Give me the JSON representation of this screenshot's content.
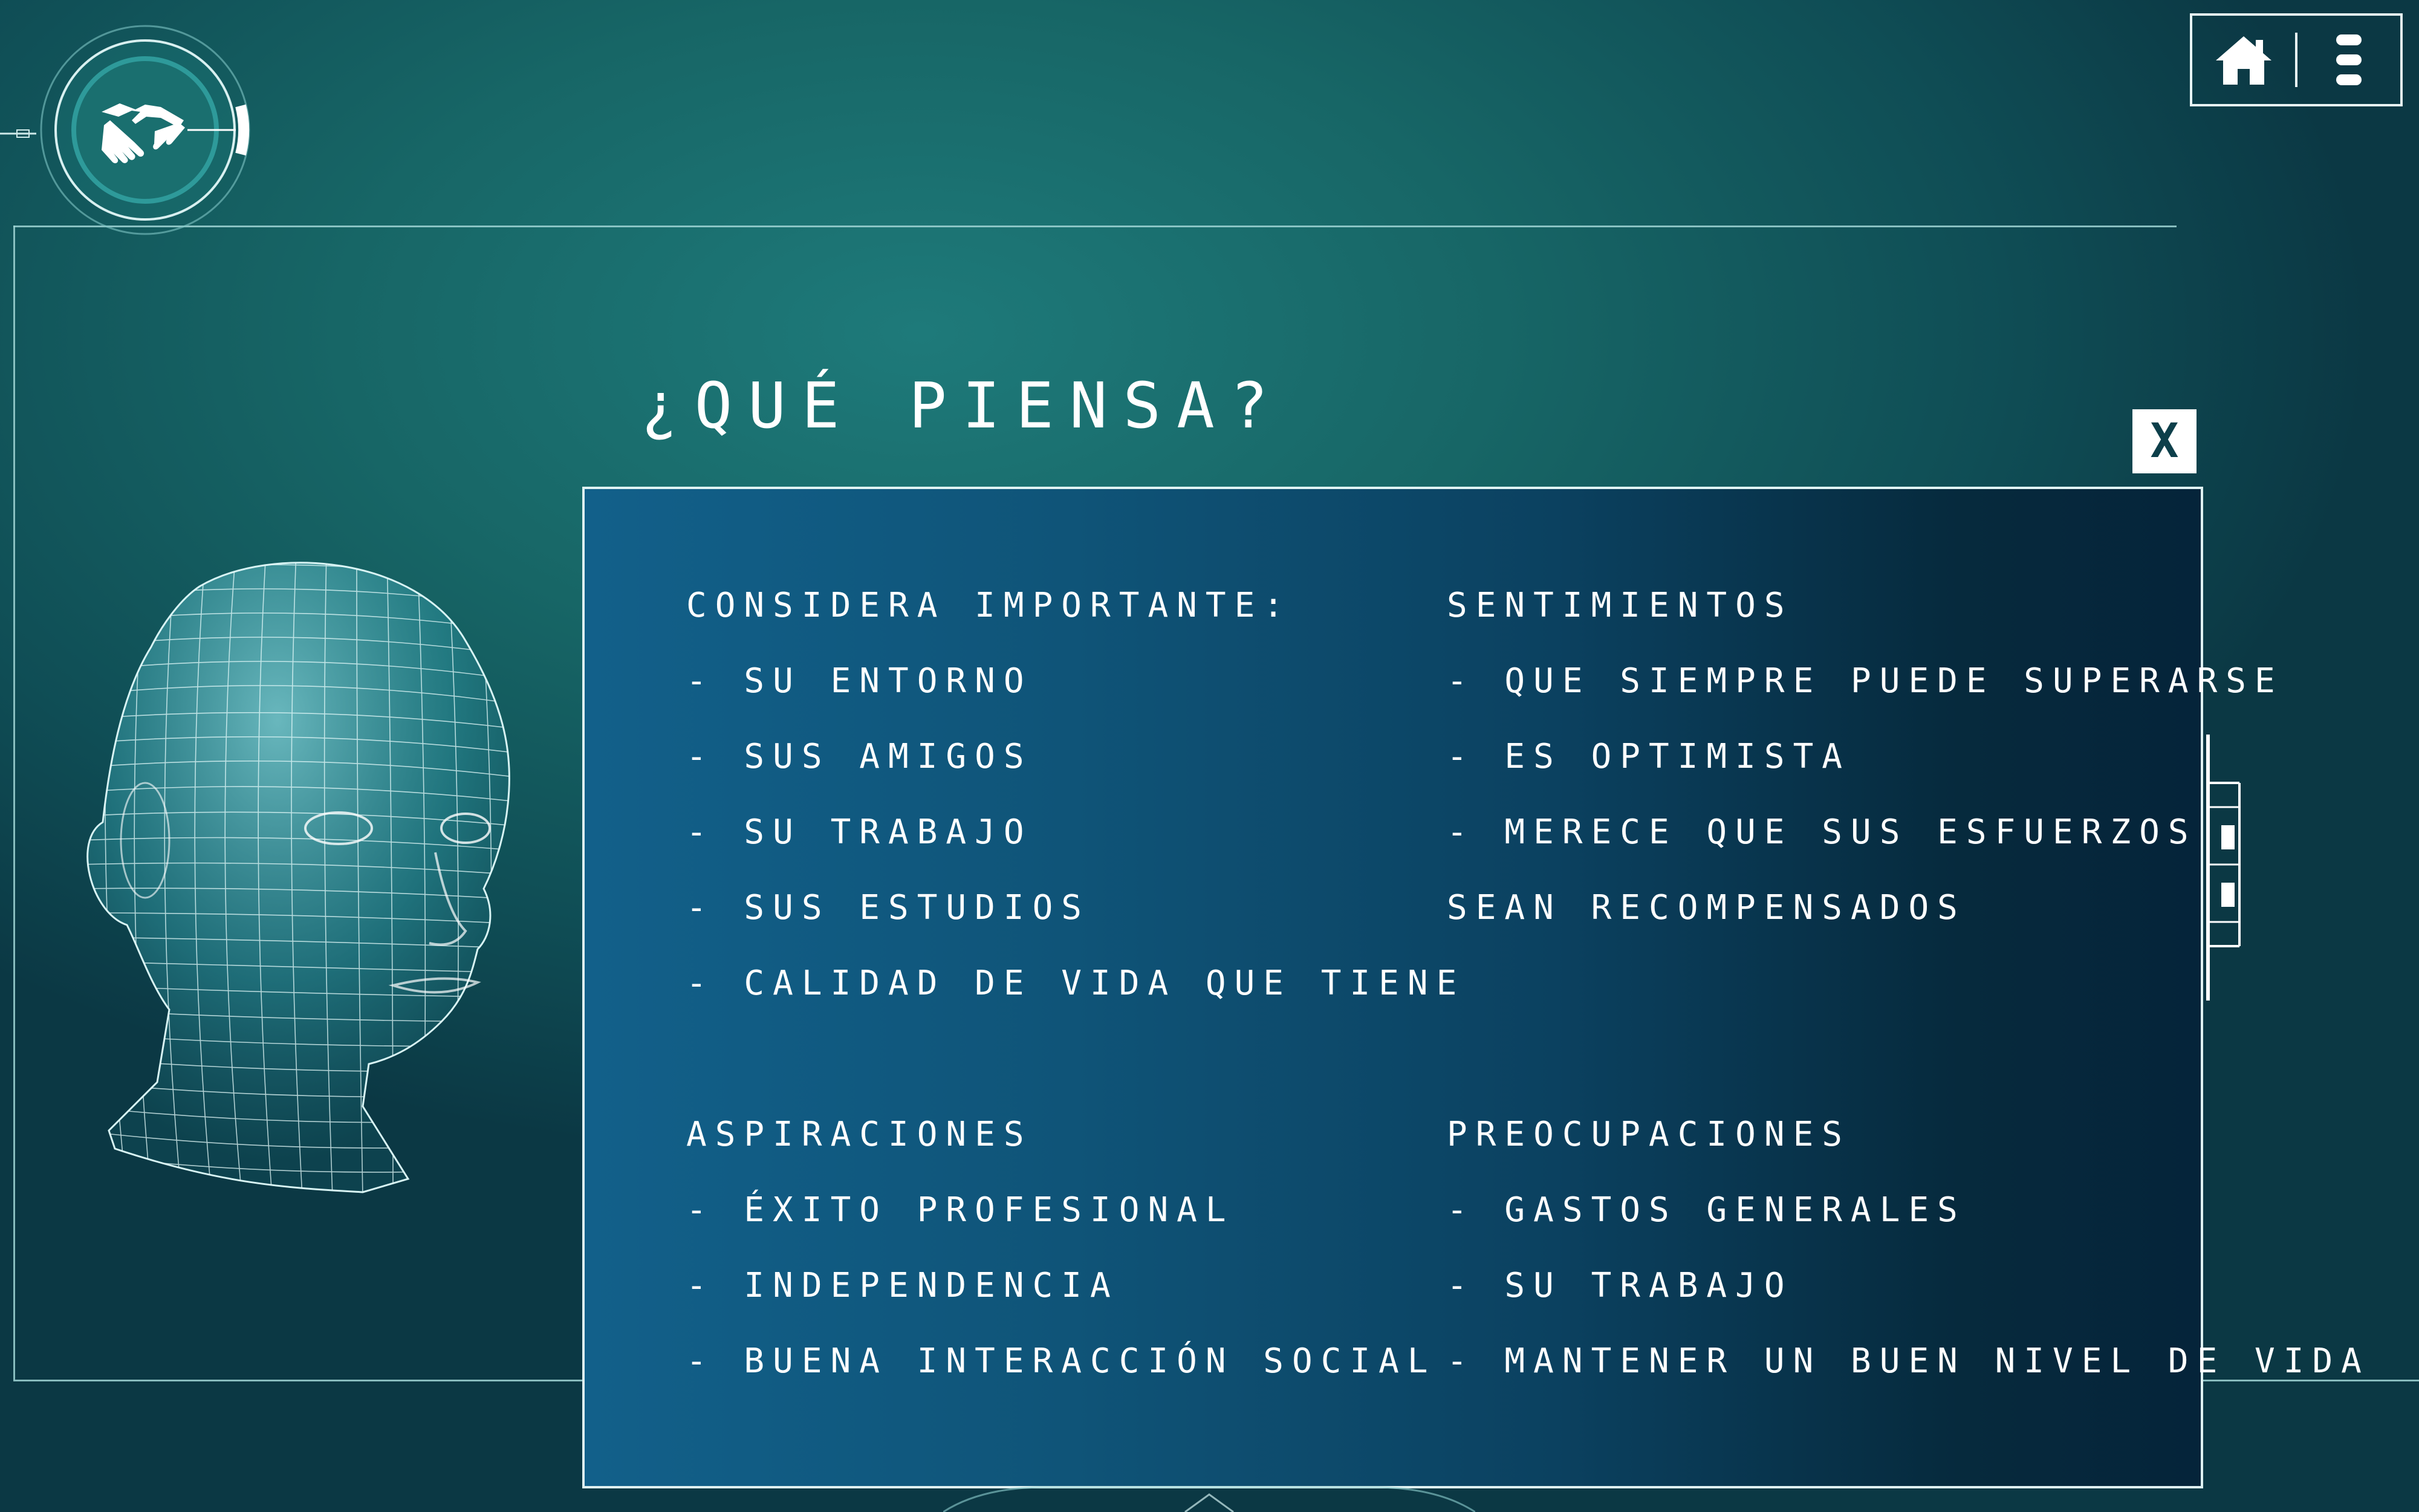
{
  "header": {
    "title": "¿QUÉ PIENSA?",
    "logo_icon": "handshake-icon",
    "home_icon": "home-icon",
    "menu_icon": "menu-dots-icon"
  },
  "close_button": {
    "label": "X"
  },
  "panel": {
    "important": {
      "heading": "CONSIDERA IMPORTANTE:",
      "items": [
        "- SU ENTORNO",
        "- SUS AMIGOS",
        "- SU TRABAJO",
        "- SUS ESTUDIOS",
        "- CALIDAD DE VIDA QUE TIENE"
      ]
    },
    "feelings": {
      "heading": "SENTIMIENTOS",
      "items": [
        "- QUE SIEMPRE PUEDE SUPERARSE",
        "- ES OPTIMISTA",
        "- MERECE QUE SUS ESFUERZOS",
        "SEAN RECOMPENSADOS"
      ]
    },
    "aspirations": {
      "heading": "ASPIRACIONES",
      "items": [
        "- ÉXITO PROFESIONAL",
        "- INDEPENDENCIA",
        "- BUENA INTERACCIÓN SOCIAL"
      ]
    },
    "worries": {
      "heading": "PREOCUPACIONES",
      "items": [
        "- GASTOS GENERALES",
        "- SU TRABAJO",
        "- MANTENER UN BUEN NIVEL DE VIDA"
      ]
    }
  },
  "colors": {
    "background": "#176666",
    "panel_left": "#12608a",
    "panel_right": "#05243a",
    "line": "#9fd4d4"
  }
}
